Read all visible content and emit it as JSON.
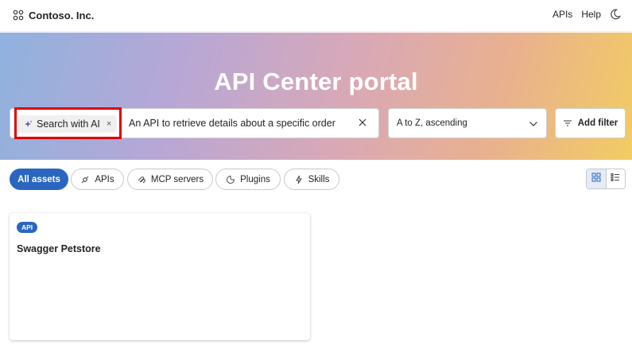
{
  "header": {
    "brand_name": "Contoso. Inc.",
    "brand_icon": "logo-grid-icon",
    "nav": [
      "APIs",
      "Help"
    ],
    "theme_icon": "moon-icon"
  },
  "hero": {
    "title": "API Center portal",
    "search": {
      "ai_chip_label": "Search with AI",
      "ai_chip_icon": "sparkle-icon",
      "chip_close": "×",
      "query": "An API to retrieve details about a specific order",
      "clear_icon": "close-icon",
      "highlighted": true
    },
    "sort": {
      "value": "A to Z, ascending",
      "icon": "chevron-down-icon"
    },
    "filter_button": "Add filter"
  },
  "filters": {
    "pills": [
      {
        "label": "All assets",
        "active": true
      },
      {
        "label": "APIs",
        "icon": "api-icon",
        "active": false
      },
      {
        "label": "MCP servers",
        "icon": "mcp-icon",
        "active": false
      },
      {
        "label": "Plugins",
        "icon": "plugin-icon",
        "active": false
      },
      {
        "label": "Skills",
        "icon": "skill-icon",
        "active": false
      }
    ],
    "view_modes": [
      {
        "name": "grid-view",
        "selected": true
      },
      {
        "name": "list-view",
        "selected": false
      }
    ]
  },
  "results": [
    {
      "badge": "API",
      "title": "Swagger Petstore"
    }
  ],
  "colors": {
    "accent": "#2a66c0",
    "highlight": "#e00000",
    "hero_gradient": [
      "#8fb2de",
      "#b7a7d6",
      "#d9a8b6",
      "#e9b18e",
      "#f2cc63"
    ]
  }
}
